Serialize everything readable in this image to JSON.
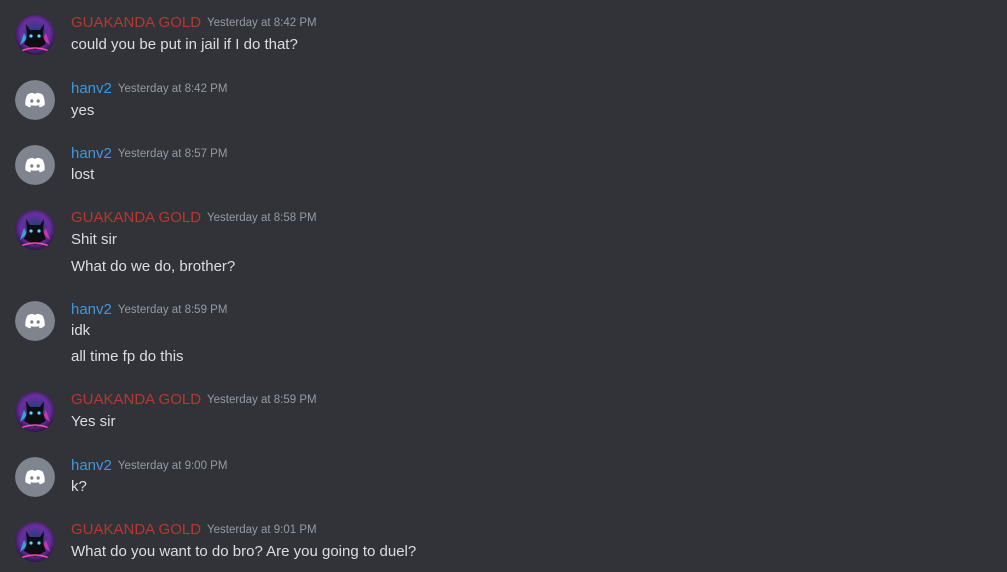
{
  "messages": [
    {
      "author": "GUAKANDA GOLD",
      "color": "#b8372f",
      "avatar_icon": "panther-avatar-icon",
      "timestamp": "Yesterday at 8:42 PM",
      "lines": [
        "could you be put in jail if I do that?"
      ]
    },
    {
      "author": "hanv2",
      "color": "#3d97dc",
      "avatar_icon": "discord-logo-icon",
      "timestamp": "Yesterday at 8:42 PM",
      "lines": [
        "yes"
      ]
    },
    {
      "author": "hanv2",
      "color": "#3d97dc",
      "avatar_icon": "discord-logo-icon",
      "timestamp": "Yesterday at 8:57 PM",
      "lines": [
        "lost"
      ]
    },
    {
      "author": "GUAKANDA GOLD",
      "color": "#b8372f",
      "avatar_icon": "panther-avatar-icon",
      "timestamp": "Yesterday at 8:58 PM",
      "lines": [
        "Shit sir",
        "What do we do, brother?"
      ]
    },
    {
      "author": "hanv2",
      "color": "#3d97dc",
      "avatar_icon": "discord-logo-icon",
      "timestamp": "Yesterday at 8:59 PM",
      "lines": [
        "idk",
        "all time fp do this"
      ]
    },
    {
      "author": "GUAKANDA GOLD",
      "color": "#b8372f",
      "avatar_icon": "panther-avatar-icon",
      "timestamp": "Yesterday at 8:59 PM",
      "lines": [
        "Yes sir"
      ]
    },
    {
      "author": "hanv2",
      "color": "#3d97dc",
      "avatar_icon": "discord-logo-icon",
      "timestamp": "Yesterday at 9:00 PM",
      "lines": [
        "k?"
      ]
    },
    {
      "author": "GUAKANDA GOLD",
      "color": "#b8372f",
      "avatar_icon": "panther-avatar-icon",
      "timestamp": "Yesterday at 9:01 PM",
      "lines": [
        "What do you want to do bro? Are you going to duel?"
      ]
    }
  ]
}
